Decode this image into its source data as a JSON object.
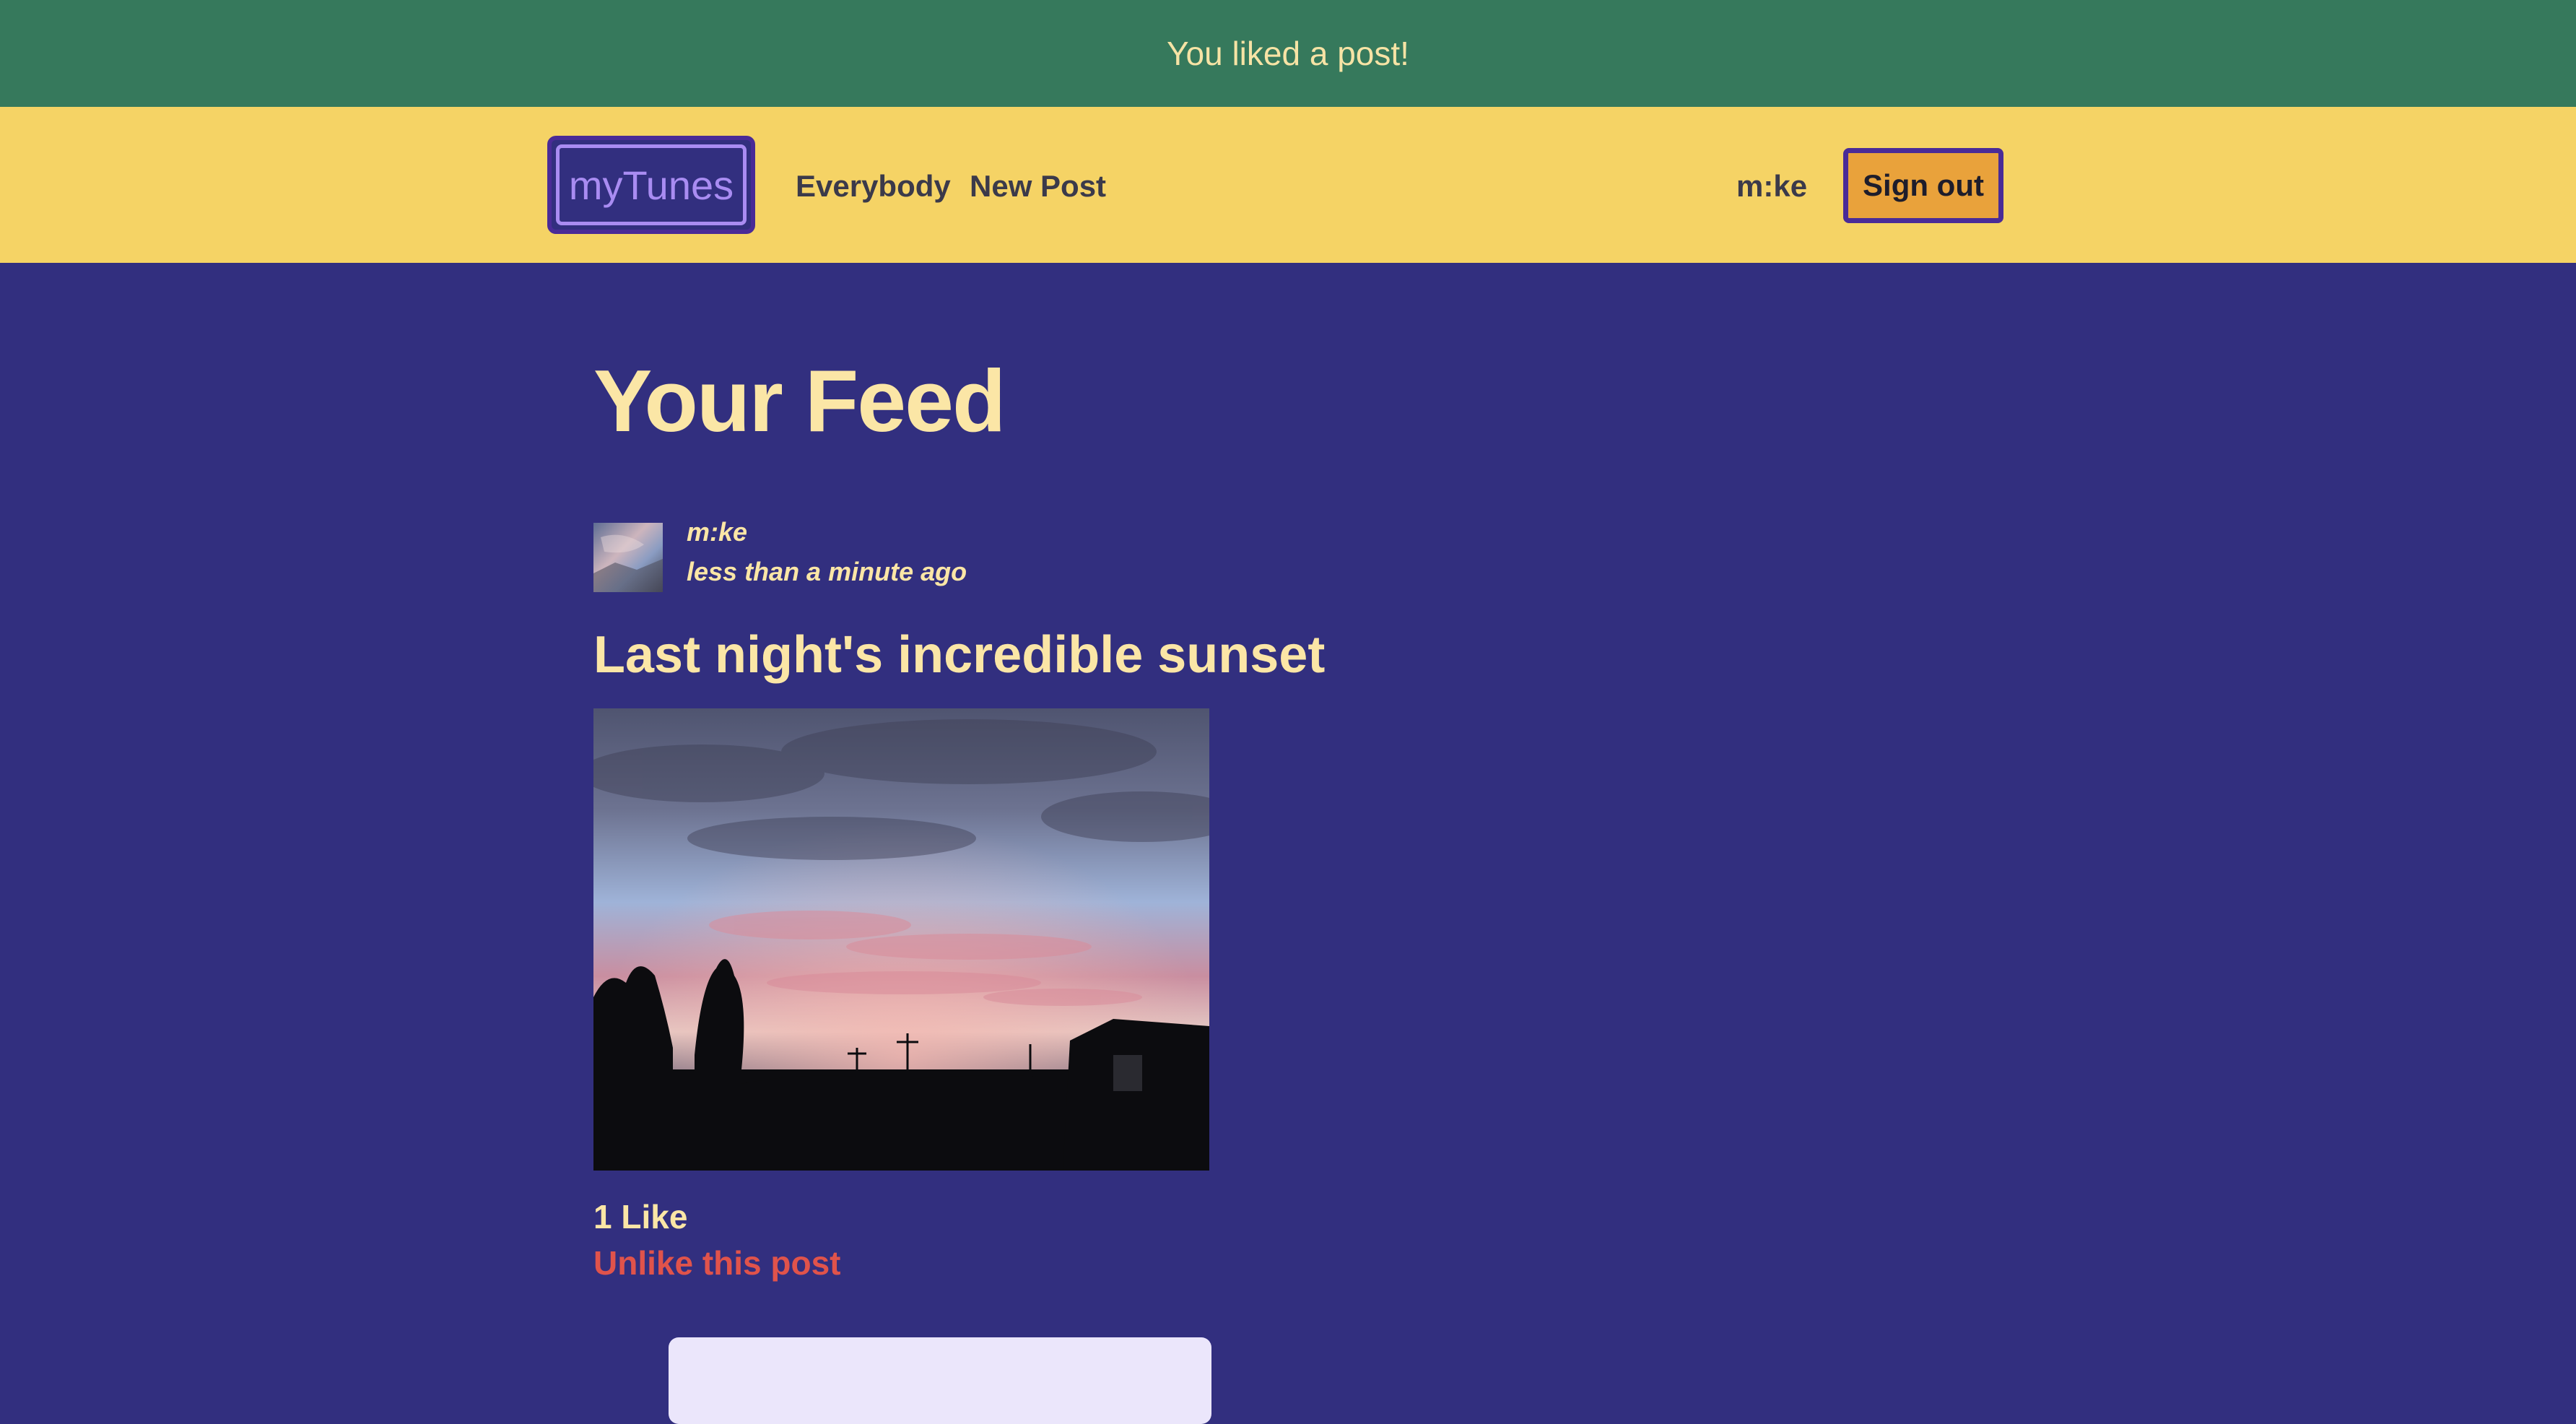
{
  "flash": {
    "message": "You liked a post!"
  },
  "navbar": {
    "brand": "myTunes",
    "links": [
      "Everybody",
      "New Post"
    ],
    "username": "m:ke",
    "signout_label": "Sign out"
  },
  "main": {
    "title": "Your Feed",
    "post": {
      "author": "m:ke",
      "timestamp": "less than a minute ago",
      "title": "Last night's incredible sunset",
      "likes": "1 Like",
      "unlike_label": "Unlike this post"
    }
  },
  "colors": {
    "flash_bg": "#36795c",
    "navbar_bg": "#f5d365",
    "page_bg": "#322f7f",
    "text_accent": "#fbe6a6",
    "unlike": "#e0534b",
    "signout_bg": "#e9a23b",
    "brand_border": "#a98cf2"
  }
}
